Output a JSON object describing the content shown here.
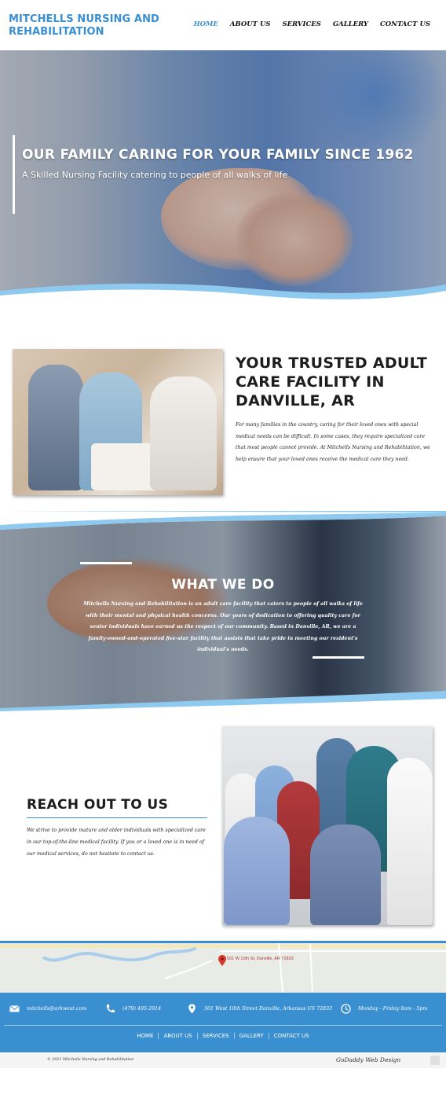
{
  "header": {
    "brand": "MITCHELLS NURSING AND REHABILITATION",
    "nav": [
      "HOME",
      "ABOUT US",
      "SERVICES",
      "GALLERY",
      "CONTACT US"
    ],
    "active_nav": "HOME"
  },
  "hero": {
    "title": "OUR FAMILY CARING FOR YOUR FAMILY SINCE 1962",
    "subtitle": "A Skilled Nursing Facility catering to people of all walks of life"
  },
  "about": {
    "title": "YOUR TRUSTED ADULT CARE FACILITY IN DANVILLE, AR",
    "text": "For many families in the country, caring for their loved ones with special medical needs can be difficult. In some cases, they require specialized care that most people cannot provide. At Mitchells Nursing and Rehabilitation, we help ensure that your loved ones receive the medical care they need."
  },
  "what_we_do": {
    "title": "WHAT WE DO",
    "text": "Mitchells Nursing and Rehabilitation is an adult care facility that caters to people of all walks of life with their mental and physical health concerns. Our years of dedication to offering quality care for senior individuals have earned us the respect of our community. Based in Danville, AR, we are a family-owned-and-operated five-star facility that assists that take pride in meeting our resident's individual's needs."
  },
  "reach": {
    "title": "REACH OUT TO US",
    "text": "We strive to provide mature and older individuals with specialized care in our top-of-the-line medical facility. If you or a loved one is in need of our medical services, do not hesitate to contact us."
  },
  "map": {
    "pin_label": "501 W 10th St, Danville, AR 72833"
  },
  "contact": {
    "email": "mitchells@arkwest.com",
    "phone": "(479) 495-2914",
    "address": "501 West 10th Street Danville, Arkansas US 72833",
    "hours": "Monday - Friday 8am - 5pm"
  },
  "footer": {
    "nav": [
      "HOME",
      "ABOUT US",
      "SERVICES",
      "GALLERY",
      "CONTACT US"
    ],
    "copyright": "© 2021 Mitchells Nursing and Rehabilitation",
    "credit": "GoDaddy Web Design"
  },
  "colors": {
    "accent": "#3a8fd1",
    "wave": "#8ec9f0"
  }
}
